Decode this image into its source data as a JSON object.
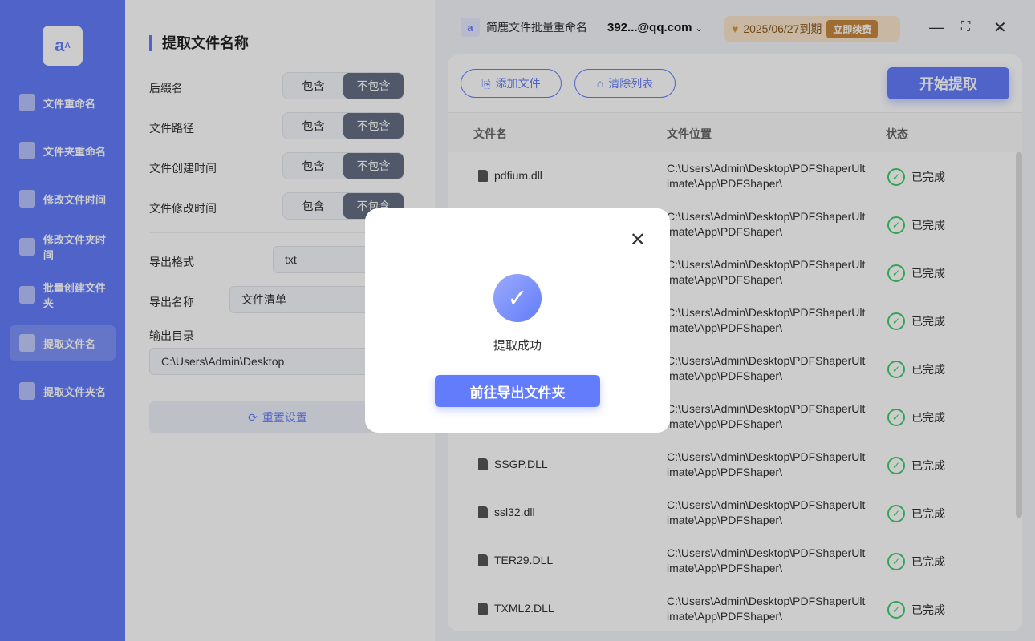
{
  "sidebar": {
    "items": [
      {
        "label": "文件重命名",
        "icon": "file-icon"
      },
      {
        "label": "文件夹重命名",
        "icon": "folder-icon"
      },
      {
        "label": "修改文件时间",
        "icon": "file-clock-icon"
      },
      {
        "label": "修改文件夹时间",
        "icon": "folder-clock-icon"
      },
      {
        "label": "批量创建文件夹",
        "icon": "folder-plus-icon"
      },
      {
        "label": "提取文件名",
        "icon": "upload-file-icon",
        "active": true
      },
      {
        "label": "提取文件夹名",
        "icon": "folder-up-icon"
      }
    ]
  },
  "settings": {
    "title": "提取文件名称",
    "include": "包含",
    "exclude": "不包含",
    "options": [
      "后缀名",
      "文件路径",
      "文件创建时间",
      "文件修改时间"
    ],
    "export_format_label": "导出格式",
    "export_format": "txt",
    "export_name_label": "导出名称",
    "export_name": "文件清单",
    "output_dir_label": "输出目录",
    "output_dir": "C:\\Users\\Admin\\Desktop",
    "reset": "重置设置"
  },
  "topbar": {
    "app_name": "简鹿文件批量重命名",
    "account": "392...@qq.com",
    "expiry": "2025/06/27到期",
    "renew": "立即续费"
  },
  "toolbar": {
    "add_file": "添加文件",
    "clear_list": "清除列表",
    "start": "开始提取"
  },
  "table": {
    "headers": [
      "文件名",
      "文件位置",
      "状态"
    ],
    "rows": [
      {
        "name": "pdfium.dll",
        "path": "C:\\Users\\Admin\\Desktop\\PDFShaperUltimate\\App\\PDFShaper\\",
        "status": "已完成"
      },
      {
        "name": "",
        "path": "C:\\Users\\Admin\\Desktop\\PDFShaperUltimate\\App\\PDFShaper\\",
        "status": "已完成"
      },
      {
        "name": "",
        "path": "C:\\Users\\Admin\\Desktop\\PDFShaperUltimate\\App\\PDFShaper\\",
        "status": "已完成"
      },
      {
        "name": "",
        "path": "C:\\Users\\Admin\\Desktop\\PDFShaperUltimate\\App\\PDFShaper\\",
        "status": "已完成"
      },
      {
        "name": "",
        "path": "C:\\Users\\Admin\\Desktop\\PDFShaperUltimate\\App\\PDFShaper\\",
        "status": "已完成"
      },
      {
        "name": "",
        "path": "C:\\Users\\Admin\\Desktop\\PDFShaperUltimate\\App\\PDFShaper\\",
        "status": "已完成"
      },
      {
        "name": "SSGP.DLL",
        "path": "C:\\Users\\Admin\\Desktop\\PDFShaperUltimate\\App\\PDFShaper\\",
        "status": "已完成"
      },
      {
        "name": "ssl32.dll",
        "path": "C:\\Users\\Admin\\Desktop\\PDFShaperUltimate\\App\\PDFShaper\\",
        "status": "已完成"
      },
      {
        "name": "TER29.DLL",
        "path": "C:\\Users\\Admin\\Desktop\\PDFShaperUltimate\\App\\PDFShaper\\",
        "status": "已完成"
      },
      {
        "name": "TXML2.DLL",
        "path": "C:\\Users\\Admin\\Desktop\\PDFShaperUltimate\\App\\PDFShaper\\",
        "status": "已完成"
      }
    ]
  },
  "modal": {
    "message": "提取成功",
    "button": "前往导出文件夹"
  }
}
